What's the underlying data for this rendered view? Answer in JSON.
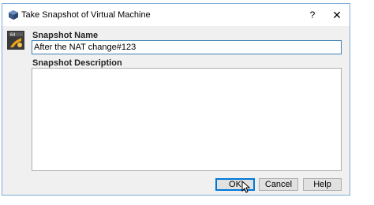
{
  "window": {
    "title": "Take Snapshot of Virtual Machine",
    "help_label": "?",
    "close_label": "✕",
    "app_icon": "virtualbox-icon",
    "vm_icon": "vm-os-icon"
  },
  "form": {
    "name_label": "Snapshot Name",
    "name_value": "After the NAT change#123",
    "description_label": "Snapshot Description",
    "description_value": ""
  },
  "buttons": {
    "ok": "OK",
    "cancel": "Cancel",
    "help": "Help"
  },
  "colors": {
    "focus_border": "#0078d7",
    "window_border": "#7fa9d6",
    "dialog_bg": "#f0f0f0"
  }
}
